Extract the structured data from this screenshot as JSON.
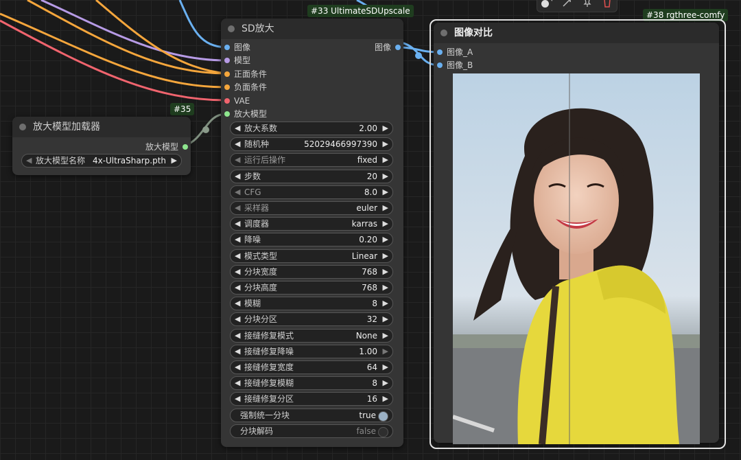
{
  "toolbar": {
    "color_icon": "color-circle-icon",
    "chevron_icon": "chevron-down-icon",
    "bypass_icon": "bypass-icon",
    "pin_icon": "pin-icon",
    "delete_icon": "trash-icon"
  },
  "upscale_node": {
    "badge": "#33 UltimateSDUpscale",
    "title": "SD放大",
    "inputs": [
      {
        "label": "图像",
        "color": "#6ab0f0"
      },
      {
        "label": "模型",
        "color": "#b79be6"
      },
      {
        "label": "正面条件",
        "color": "#f5a63c"
      },
      {
        "label": "负面条件",
        "color": "#f5a63c"
      },
      {
        "label": "VAE",
        "color": "#f0646e"
      },
      {
        "label": "放大模型",
        "color": "#8ee68e"
      }
    ],
    "output": {
      "label": "图像",
      "color": "#6ab0f0"
    },
    "widgets": [
      {
        "label": "放大系数",
        "value": "2.00",
        "disabled": false
      },
      {
        "label": "随机种",
        "value": "52029466997390",
        "disabled": false
      },
      {
        "label": "运行后操作",
        "value": "fixed",
        "disabled": true
      },
      {
        "label": "步数",
        "value": "20",
        "disabled": false
      },
      {
        "label": "CFG",
        "value": "8.0",
        "disabled": true
      },
      {
        "label": "采样器",
        "value": "euler",
        "disabled": true
      },
      {
        "label": "调度器",
        "value": "karras",
        "disabled": false
      },
      {
        "label": "降噪",
        "value": "0.20",
        "disabled": false
      },
      {
        "label": "模式类型",
        "value": "Linear",
        "disabled": false
      },
      {
        "label": "分块宽度",
        "value": "768",
        "disabled": false
      },
      {
        "label": "分块高度",
        "value": "768",
        "disabled": false
      },
      {
        "label": "模糊",
        "value": "8",
        "disabled": false
      },
      {
        "label": "分块分区",
        "value": "32",
        "disabled": false
      },
      {
        "label": "接缝修复模式",
        "value": "None",
        "disabled": false
      },
      {
        "label": "接缝修复降噪",
        "value": "1.00",
        "disabled": false,
        "right_dim": true
      },
      {
        "label": "接缝修复宽度",
        "value": "64",
        "disabled": false
      },
      {
        "label": "接缝修复模糊",
        "value": "8",
        "disabled": false
      },
      {
        "label": "接缝修复分区",
        "value": "16",
        "disabled": false
      }
    ],
    "toggles": [
      {
        "label": "强制统一分块",
        "value": "true",
        "on": true
      },
      {
        "label": "分块解码",
        "value": "false",
        "on": false
      }
    ]
  },
  "loader_node": {
    "badge": "#35",
    "title": "放大模型加载器",
    "output": {
      "label": "放大模型",
      "color": "#8ee68e"
    },
    "widget": {
      "label": "放大模型名称",
      "value": "4x-UltraSharp.pth"
    }
  },
  "compare_node": {
    "badge": "#38 rgthree-comfy",
    "title": "图像对比",
    "inputs": [
      {
        "label": "图像_A",
        "color": "#6ab0f0"
      },
      {
        "label": "图像_B",
        "color": "#6ab0f0"
      }
    ],
    "preview_alt": "smiling girl in yellow hoodie"
  },
  "colors": {
    "wire_image": "#6ab0f0",
    "wire_model": "#b79be6",
    "wire_conditioning": "#f5a63c",
    "wire_vae": "#f0646e",
    "wire_upscale_model": "#7f8f7f",
    "badge_bg": "#1f3d1f",
    "node_bg": "#353535",
    "selected_outline": "#ffffff"
  }
}
